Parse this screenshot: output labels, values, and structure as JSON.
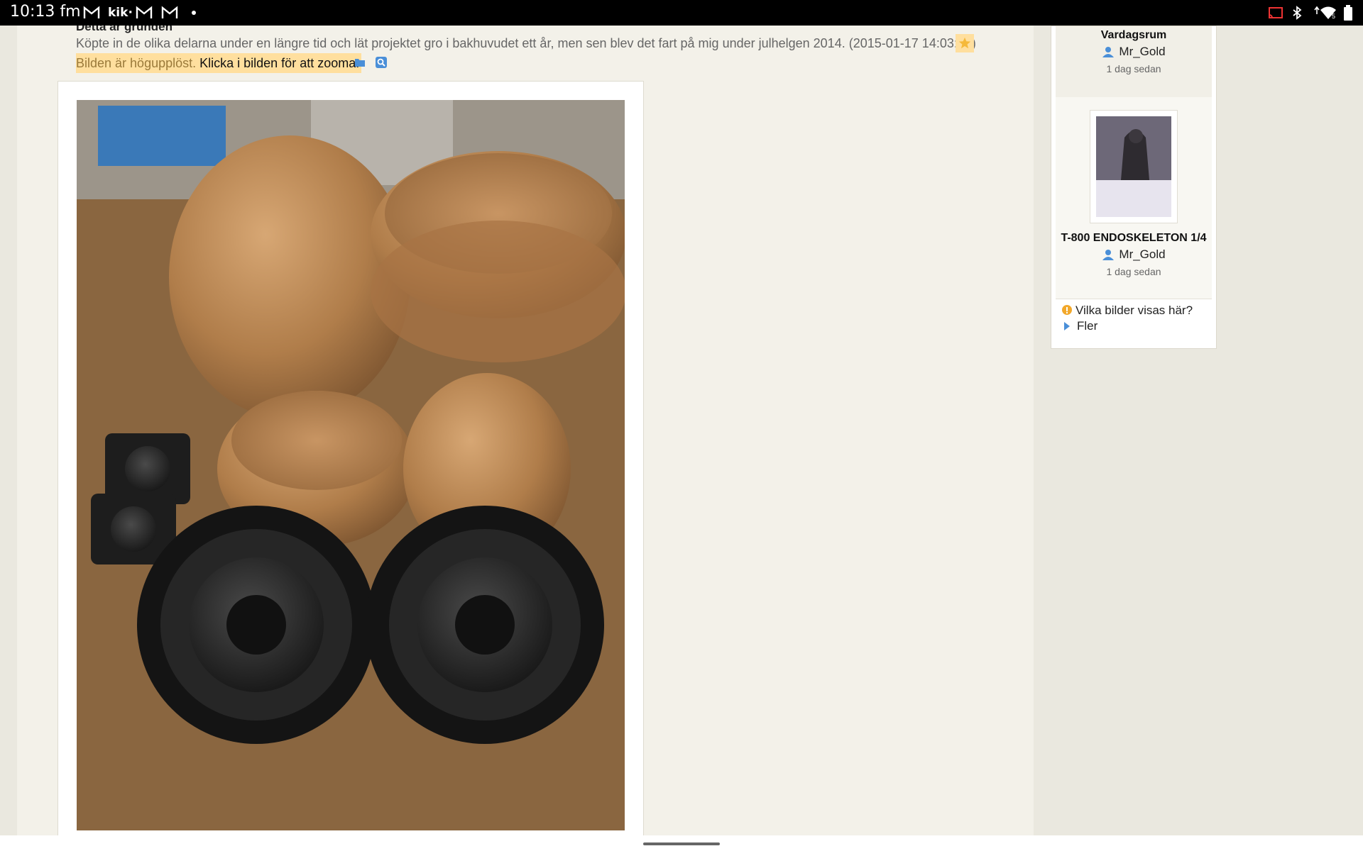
{
  "status_bar": {
    "time": "10:13 fm",
    "notification_icons": [
      "gmail-icon",
      "kik-icon",
      "gmail-icon",
      "gmail-icon",
      "more-notifications-dot"
    ],
    "kik_label": "kik·",
    "right_icons": [
      "cast-icon",
      "bluetooth-icon",
      "wifi-icon",
      "battery-icon"
    ],
    "wifi_badge": "5"
  },
  "post": {
    "title": "Detta är grunden",
    "description": "Köpte in de olika delarna under en längre tid och lät projektet gro i bakhuvudet ett år, men sen blev det fart på mig under julhelgen 2014.",
    "timestamp": "(2015-01-17 14:03:35)",
    "hires_notice": "Bilden är högupplöst.",
    "zoom_hint": "Klicka i bilden för att zooma.",
    "photo_description": "Wooden bamboo bowls with speaker drivers on a table"
  },
  "sidebar": {
    "items": [
      {
        "title": "Vardagsrum",
        "user": "Mr_Gold",
        "time": "1 dag sedan"
      },
      {
        "title": "T-800 ENDOSKELETON 1/4",
        "user": "Mr_Gold",
        "time": "1 dag sedan"
      }
    ],
    "info_link": "Vilka bilder visas här?",
    "more_link": "Fler"
  },
  "colors": {
    "highlight": "#ffdf9e",
    "page_bg": "#f3f1e9",
    "link_blue": "#4a8fd8"
  }
}
